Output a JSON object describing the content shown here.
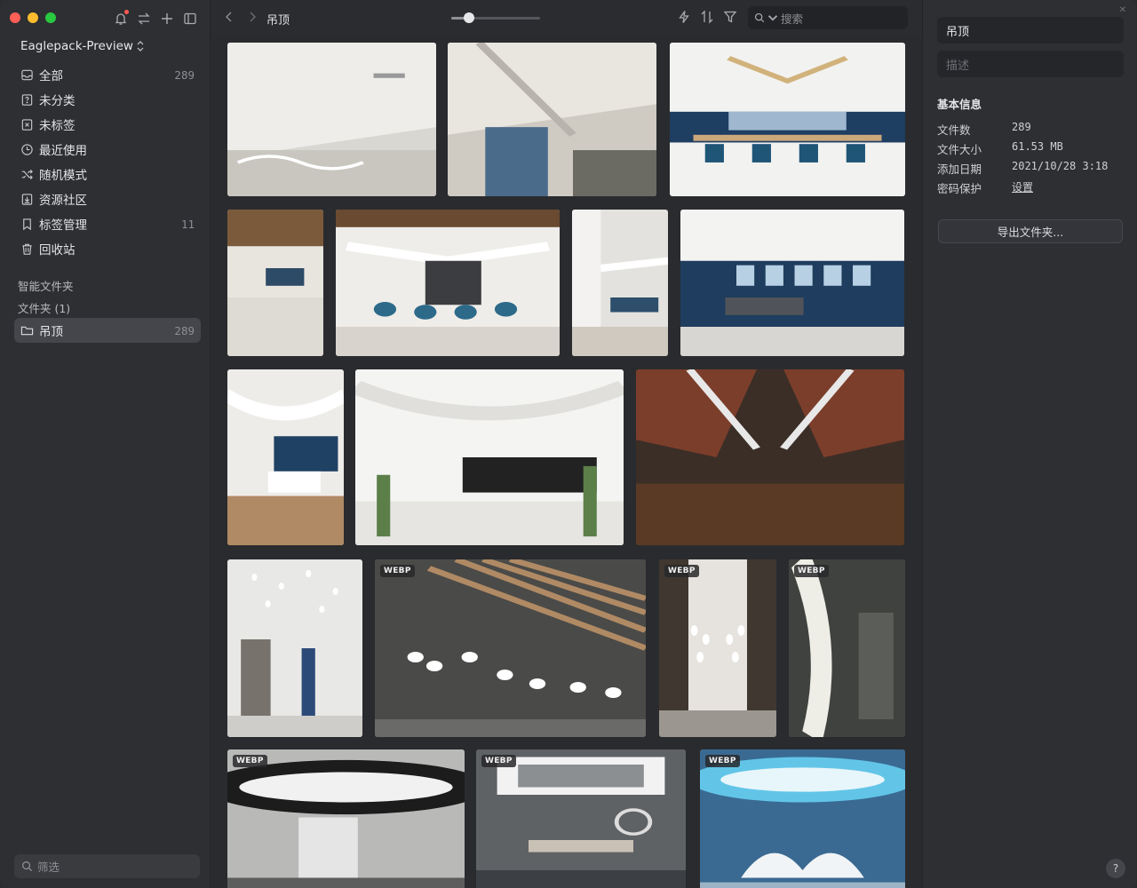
{
  "library": {
    "name": "Eaglepack-Preview",
    "switch_glyph": "⌃"
  },
  "sidebar": {
    "items": [
      {
        "label": "全部",
        "count": "289",
        "icon": "inbox-icon"
      },
      {
        "label": "未分类",
        "count": "",
        "icon": "question-box-icon"
      },
      {
        "label": "未标签",
        "count": "",
        "icon": "tag-x-icon"
      },
      {
        "label": "最近使用",
        "count": "",
        "icon": "clock-icon"
      },
      {
        "label": "随机模式",
        "count": "",
        "icon": "shuffle-icon"
      },
      {
        "label": "资源社区",
        "count": "",
        "icon": "download-box-icon"
      },
      {
        "label": "标签管理",
        "count": "11",
        "icon": "bookmark-icon"
      },
      {
        "label": "回收站",
        "count": "",
        "icon": "trash-icon"
      }
    ],
    "smart_folders_label": "智能文件夹",
    "folders_label": "文件夹 (1)",
    "folders": [
      {
        "label": "吊顶",
        "count": "289",
        "active": true
      }
    ],
    "filter_placeholder": "筛选"
  },
  "toolbar": {
    "title": "吊顶",
    "zoom_value": 0.2,
    "search_placeholder": "搜索"
  },
  "grid": {
    "items": [
      {
        "badge": ""
      },
      {
        "badge": ""
      },
      {
        "badge": ""
      },
      {
        "badge": ""
      },
      {
        "badge": ""
      },
      {
        "badge": ""
      },
      {
        "badge": ""
      },
      {
        "badge": ""
      },
      {
        "badge": ""
      },
      {
        "badge": ""
      },
      {
        "badge": ""
      },
      {
        "badge": "WEBP"
      },
      {
        "badge": "WEBP"
      },
      {
        "badge": "WEBP"
      },
      {
        "badge": "WEBP"
      },
      {
        "badge": "WEBP"
      },
      {
        "badge": "WEBP"
      }
    ]
  },
  "inspector": {
    "name": "吊顶",
    "desc_placeholder": "描述",
    "section_title": "基本信息",
    "info": [
      {
        "key": "文件数",
        "value": "289"
      },
      {
        "key": "文件大小",
        "value": "61.53 MB"
      },
      {
        "key": "添加日期",
        "value": "2021/10/28 3:18"
      },
      {
        "key": "密码保护",
        "value": "设置"
      }
    ],
    "export_label": "导出文件夹..."
  },
  "help_label": "?"
}
